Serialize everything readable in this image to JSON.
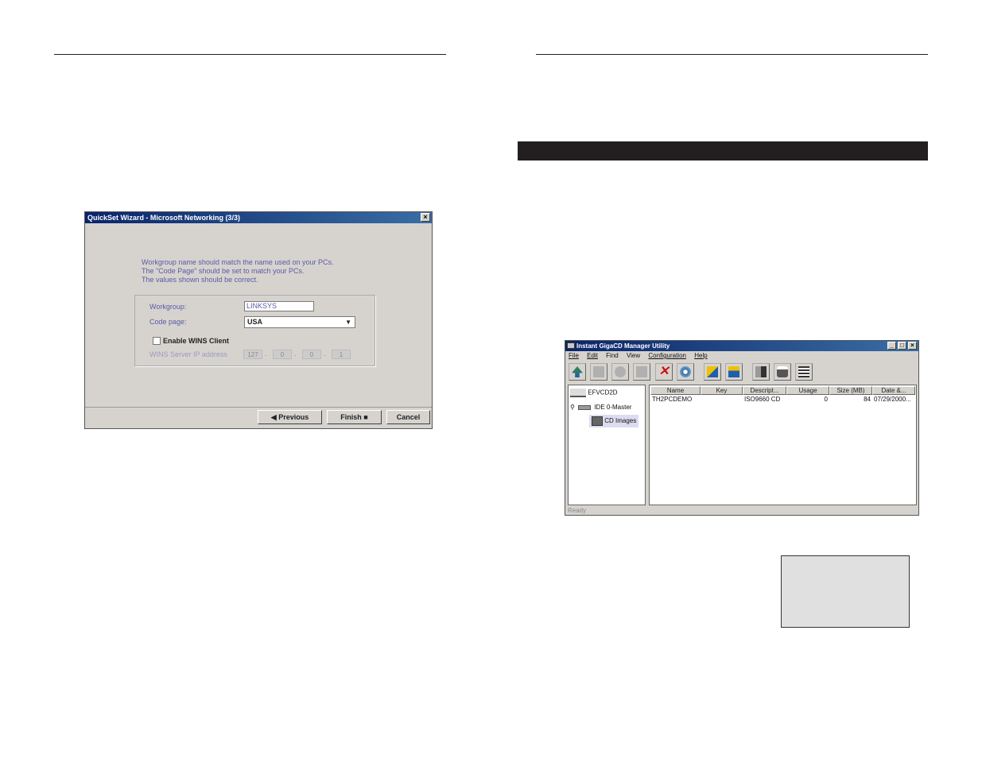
{
  "wizard": {
    "title": "QuickSet Wizard - Microsoft Networking (3/3)",
    "close_label": "×",
    "message_lines": [
      "Workgroup name should match the name used on your PCs.",
      "The \"Code Page\" should be set to match your PCs.",
      "The values shown should be correct."
    ],
    "workgroup_label": "Workgroup:",
    "workgroup_value": "LINKSYS",
    "codepage_label": "Code page:",
    "codepage_value": "USA",
    "wins_checkbox_label": "Enable WINS Client",
    "wins_ip_label": "WINS Server IP address",
    "wins_ip": [
      "127",
      "0",
      "0",
      "1"
    ],
    "buttons": {
      "previous": "Previous",
      "finish": "Finish",
      "cancel": "Cancel"
    }
  },
  "gigacd": {
    "title": "Instant GigaCD Manager Utility",
    "window_controls": [
      "_",
      "□",
      "×"
    ],
    "menu": [
      "File",
      "Edit",
      "Find",
      "View",
      "Configuration",
      "Help"
    ],
    "tree": {
      "root": "EFVCD2D",
      "device": "IDE 0-Master",
      "folder": "CD Images"
    },
    "columns": [
      "Name",
      "Key",
      "Descript...",
      "Usage",
      "Size (MB)",
      "Date &..."
    ],
    "rows": [
      [
        "TH2PCDEMO",
        "",
        "ISO9660 CD",
        "0",
        "84",
        "07/29/2000..."
      ]
    ],
    "status": "Ready",
    "colors": {
      "titlebar_start": "#0a246a",
      "titlebar_end": "#3a6ea5",
      "section_bar": "#231f20"
    }
  }
}
